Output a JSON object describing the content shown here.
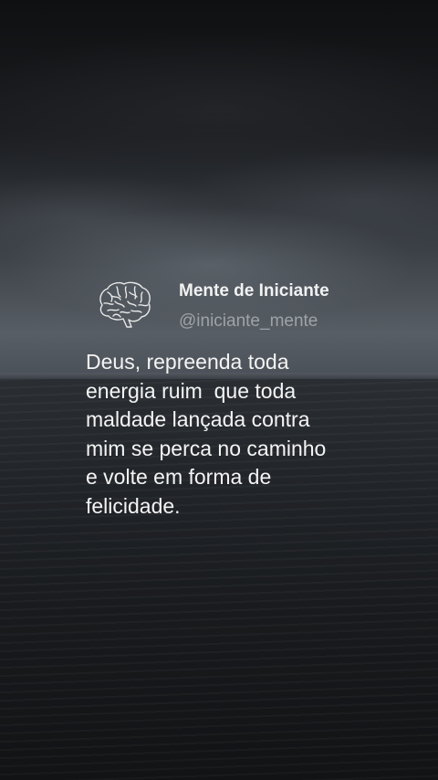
{
  "author": {
    "name": "Mente de Iniciante",
    "handle": "@iniciante_mente",
    "avatar_icon": "brain-icon"
  },
  "quote": {
    "lines": [
      "Deus, repreenda toda",
      "energia ruim  que toda",
      "maldade lançada contra",
      "mim se perca no caminho",
      "e volte em forma de",
      "felicidade."
    ]
  },
  "colors": {
    "text": "#f4f4f4",
    "handle": "#9ea3a8",
    "sea": "#202327",
    "sky_light": "#585e65"
  }
}
